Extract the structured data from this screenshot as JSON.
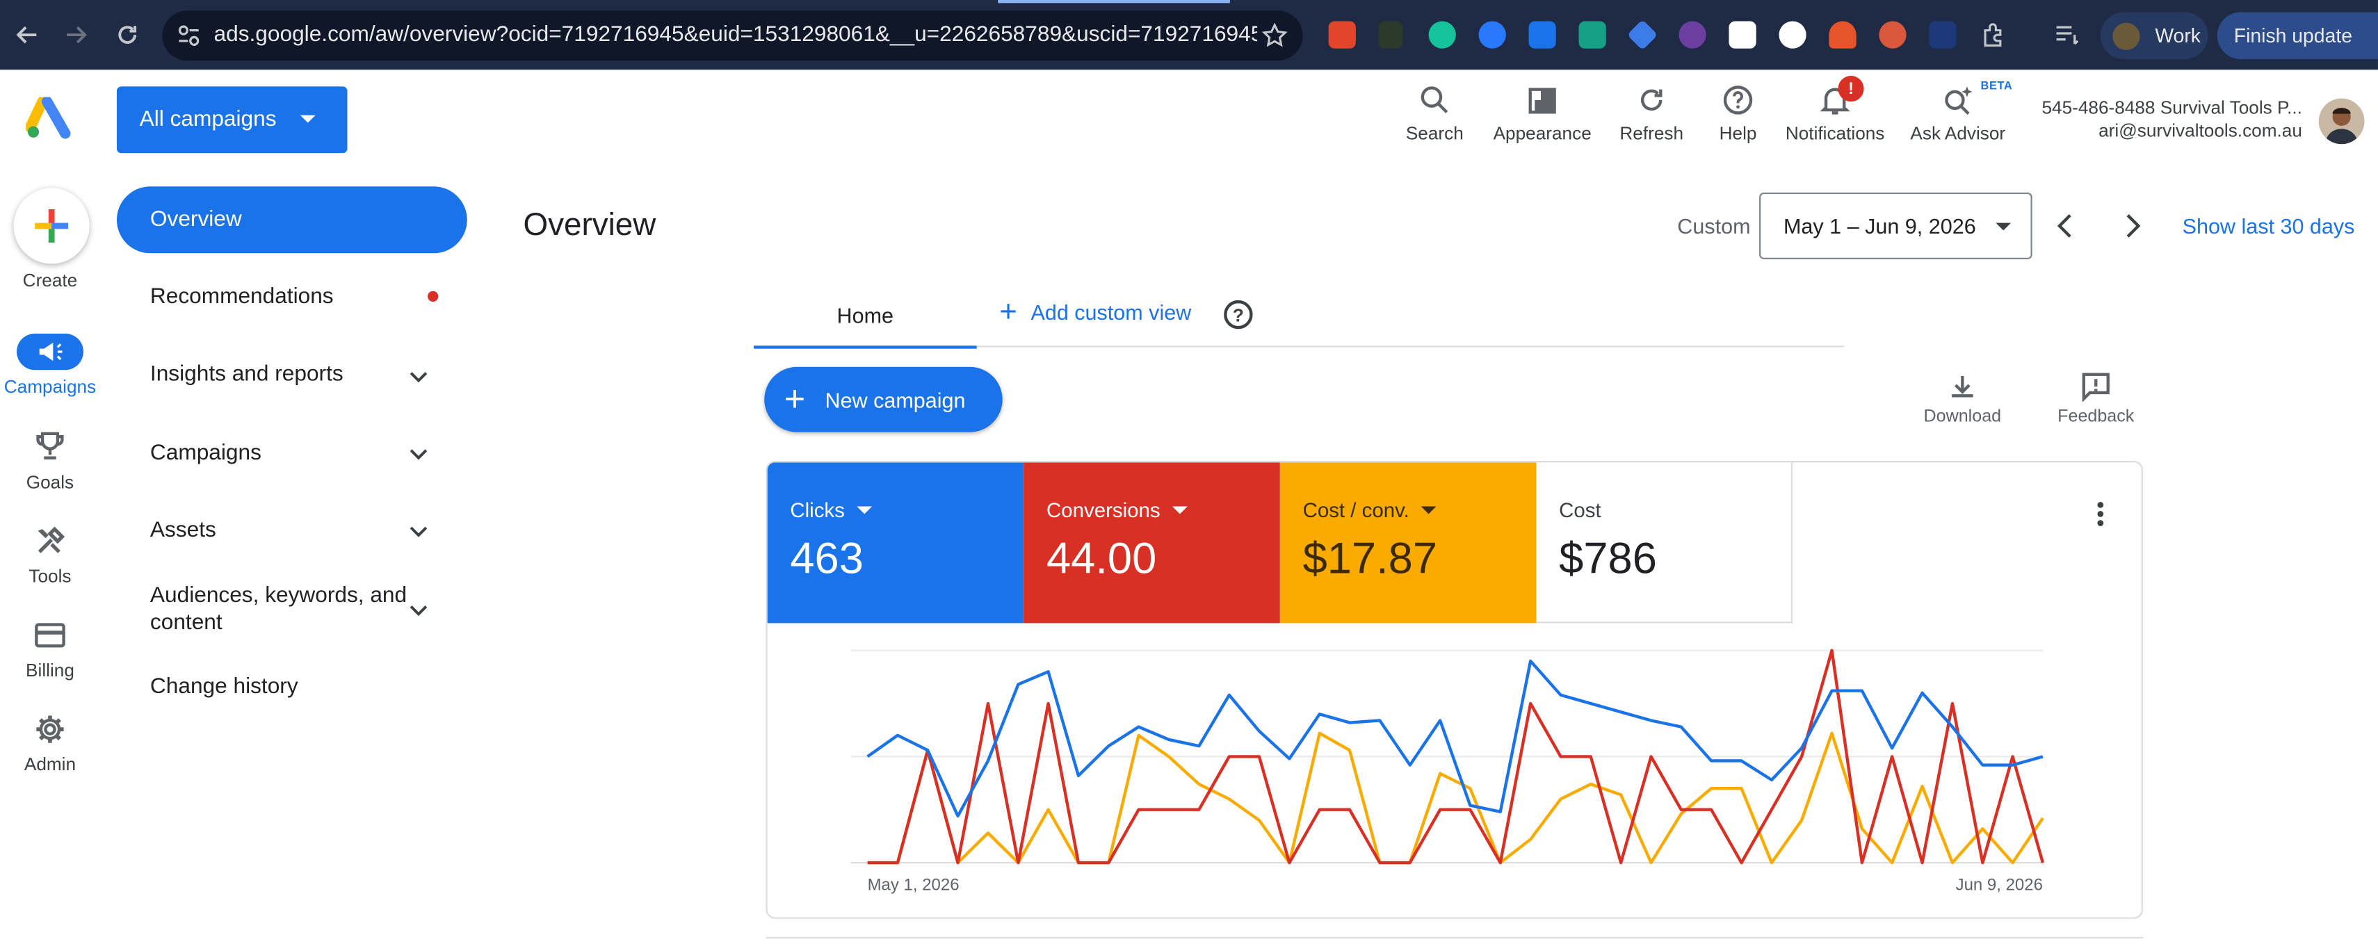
{
  "browser": {
    "url": "ads.google.com/aw/overview?ocid=7192716945&euid=1531298061&__u=2262658789&uscid=7192716945&_...",
    "profile": "Work",
    "update_button": "Finish update"
  },
  "header": {
    "account_switcher": "All campaigns",
    "tools": [
      {
        "label": "Search",
        "icon": "search-icon"
      },
      {
        "label": "Appearance",
        "icon": "appearance-icon"
      },
      {
        "label": "Refresh",
        "icon": "refresh-icon"
      },
      {
        "label": "Help",
        "icon": "help-icon"
      },
      {
        "label": "Notifications",
        "icon": "bell-icon"
      },
      {
        "label": "Ask Advisor",
        "icon": "sparkle-search-icon"
      }
    ],
    "beta_tag": "BETA",
    "notification_badge": "!",
    "account_line1": "545-486-8488 Survival Tools P...",
    "account_line2": "ari@survivaltools.com.au"
  },
  "rail": {
    "create": "Create",
    "campaigns": "Campaigns",
    "goals": "Goals",
    "tools": "Tools",
    "billing": "Billing",
    "admin": "Admin"
  },
  "sidenav": {
    "overview": "Overview",
    "recommendations": "Recommendations",
    "insights": "Insights and reports",
    "campaigns": "Campaigns",
    "assets": "Assets",
    "audiences": "Audiences, keywords, and content",
    "change_history": "Change history"
  },
  "main": {
    "title": "Overview",
    "custom_label": "Custom",
    "date_range": "May 1 – Jun 9, 2026",
    "show_last": "Show last 30 days",
    "tab_home": "Home",
    "add_custom_view": "Add custom view",
    "new_campaign": "New campaign",
    "download": "Download",
    "feedback": "Feedback",
    "metrics": [
      {
        "label": "Clicks",
        "value": "463",
        "color": "#1a73e8",
        "has_caret": true
      },
      {
        "label": "Conversions",
        "value": "44.00",
        "color": "#d93025",
        "has_caret": true
      },
      {
        "label": "Cost / conv.",
        "value": "$17.87",
        "color": "#f9ab00",
        "has_caret": true
      },
      {
        "label": "Cost",
        "value": "$786",
        "color": "#ffffff",
        "has_caret": false
      }
    ]
  },
  "chart_data": {
    "type": "line",
    "x_start_label": "May 1, 2026",
    "x_end_label": "Jun 9, 2026",
    "series": [
      {
        "color": "#1a73e8",
        "values": [
          50,
          60,
          53,
          22,
          48,
          84,
          90,
          41,
          55,
          64,
          58,
          55,
          79,
          62,
          49,
          70,
          66,
          67,
          46,
          67,
          27,
          24,
          95,
          79,
          75,
          71,
          67,
          64,
          48,
          48,
          39,
          54,
          81,
          81,
          54,
          80,
          64,
          46,
          46,
          50
        ]
      },
      {
        "color": "#d93025",
        "values": [
          0,
          0,
          53,
          0,
          75,
          0,
          75,
          0,
          0,
          25,
          25,
          25,
          50,
          50,
          0,
          25,
          25,
          0,
          0,
          25,
          25,
          0,
          75,
          50,
          50,
          0,
          50,
          25,
          25,
          0,
          25,
          50,
          100,
          0,
          50,
          0,
          75,
          0,
          50,
          0
        ]
      },
      {
        "color": "#f9ab00",
        "values": [
          0,
          0,
          53,
          0,
          14,
          0,
          25,
          0,
          0,
          60,
          50,
          37,
          30,
          20,
          0,
          61,
          53,
          0,
          0,
          42,
          35,
          0,
          11,
          30,
          37,
          32,
          0,
          23,
          35,
          35,
          0,
          20,
          61,
          16,
          0,
          36,
          0,
          16,
          0,
          21
        ]
      }
    ],
    "ylim": [
      0,
      100
    ]
  },
  "colors": {
    "accent": "#1a73e8",
    "red": "#d93025",
    "yellow": "#f9ab00"
  }
}
